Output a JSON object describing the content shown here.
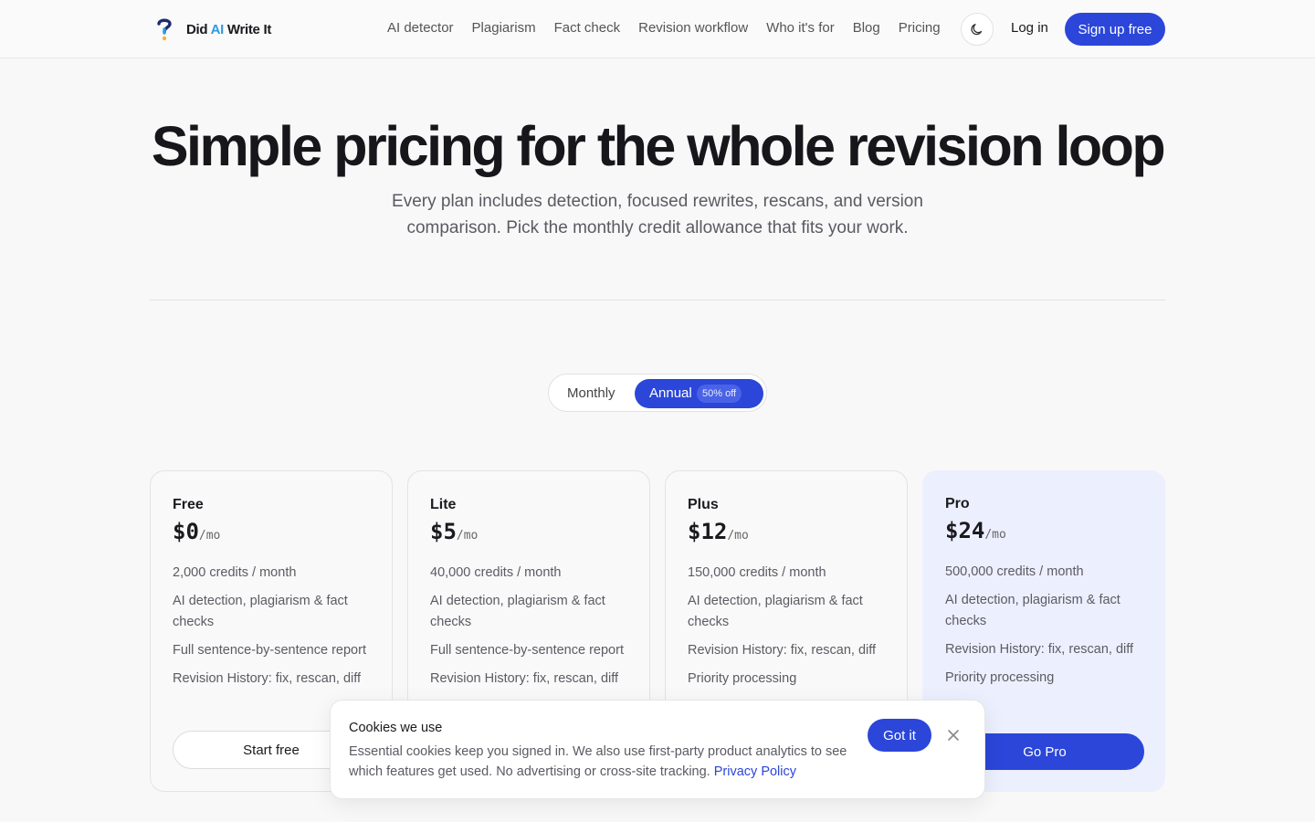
{
  "header": {
    "brand_pre": "Did ",
    "brand_ai": "AI",
    "brand_post": " Write It",
    "nav": [
      "AI detector",
      "Plagiarism",
      "Fact check",
      "Revision workflow",
      "Who it's for",
      "Blog",
      "Pricing"
    ],
    "login": "Log in",
    "signup": "Sign up free",
    "theme_icon": "moon-icon"
  },
  "hero": {
    "title": "Simple pricing for the whole revision loop",
    "subtitle": "Every plan includes detection, focused rewrites, rescans, and version comparison. Pick the monthly credit allowance that fits your work."
  },
  "billing_toggle": {
    "monthly": "Monthly",
    "annual": "Annual",
    "annual_badge": "50% off",
    "selected": "Annual"
  },
  "plans": [
    {
      "name": "Free",
      "price": "$0",
      "per": "/mo",
      "features": [
        "2,000 credits / month",
        "AI detection, plagiarism & fact checks",
        "Full sentence-by-sentence report",
        "Revision History: fix, rescan, diff"
      ],
      "cta": "Start free"
    },
    {
      "name": "Lite",
      "price": "$5",
      "per": "/mo",
      "features": [
        "40,000 credits / month",
        "AI detection, plagiarism & fact checks",
        "Full sentence-by-sentence report",
        "Revision History: fix, rescan, diff"
      ],
      "cta": ""
    },
    {
      "name": "Plus",
      "price": "$12",
      "per": "/mo",
      "features": [
        "150,000 credits / month",
        "AI detection, plagiarism & fact checks",
        "Revision History: fix, rescan, diff",
        "Priority processing"
      ],
      "cta": ""
    },
    {
      "name": "Pro",
      "price": "$24",
      "per": "/mo",
      "features": [
        "500,000 credits / month",
        "AI detection, plagiarism & fact checks",
        "Revision History: fix, rescan, diff",
        "Priority processing"
      ],
      "cta": "Go Pro"
    }
  ],
  "cookie": {
    "title": "Cookies we use",
    "body": "Essential cookies keep you signed in. We also use first-party product analytics to see which features get used. No advertising or cross-site tracking.",
    "link": "Privacy Policy",
    "accept": "Got it"
  },
  "colors": {
    "accent": "#2b46d9",
    "brand_ai": "#2f9be0",
    "pro_bg": "#eceffd"
  }
}
